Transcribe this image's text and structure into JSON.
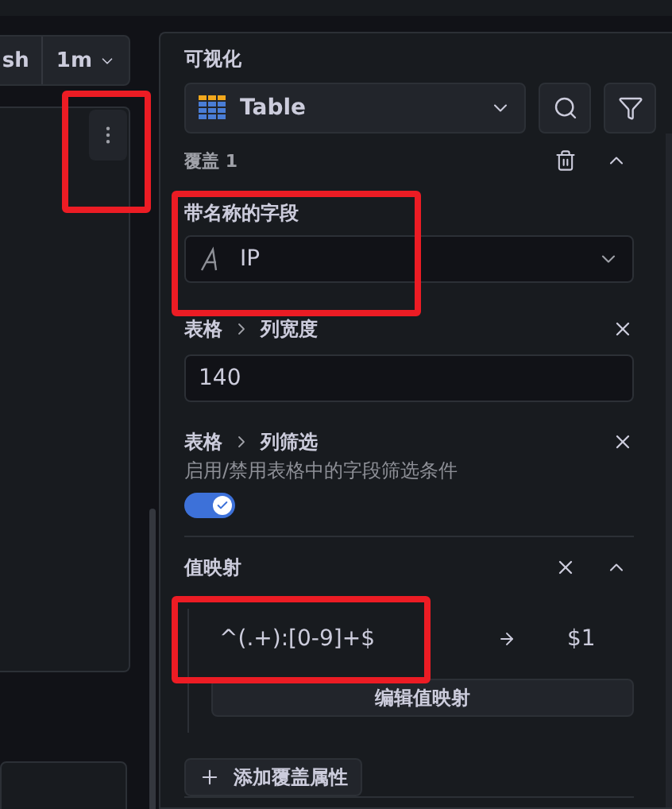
{
  "toolbar": {
    "refresh_label": "sh",
    "interval": "1m"
  },
  "panel_menu": {
    "highlighted": true
  },
  "visualization": {
    "label": "可视化",
    "selected": "Table"
  },
  "override": {
    "title": "覆盖 1",
    "expanded": true,
    "properties": [
      {
        "kind": "field_select",
        "label": "带名称的字段",
        "value": "IP",
        "highlighted": true
      },
      {
        "kind": "number",
        "path": [
          "表格",
          "列宽度"
        ],
        "value": "140"
      },
      {
        "kind": "switch",
        "path": [
          "表格",
          "列筛选"
        ],
        "description": "启用/禁用表格中的字段筛选条件",
        "on": true
      },
      {
        "kind": "mappings",
        "label": "值映射",
        "expanded": true,
        "edit_button": "编辑值映射",
        "mappings": [
          {
            "match": "^(.+):[0-9]+$",
            "result": "$1",
            "highlighted": true
          }
        ]
      }
    ]
  },
  "add_override_button": "添加覆盖属性"
}
